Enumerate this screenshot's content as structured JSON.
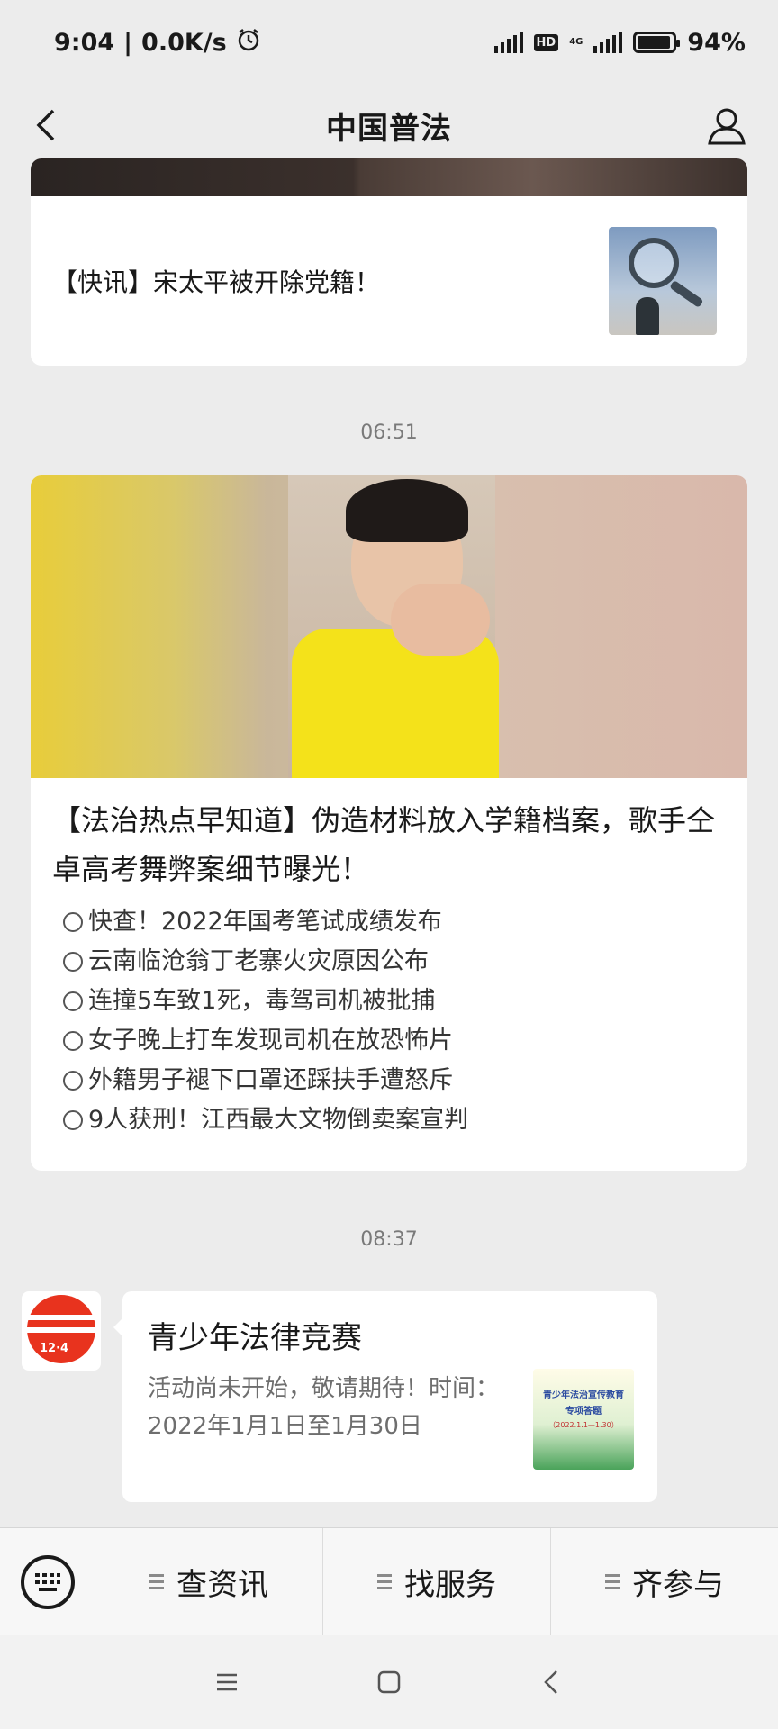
{
  "status_bar": {
    "time": "9:04",
    "net_speed": "0.0K/s",
    "hd": "HD",
    "network": "4G",
    "battery": "94%",
    "battery_level": 0.94,
    "icons": [
      "alarm-icon",
      "signal-icon",
      "battery-icon"
    ]
  },
  "nav": {
    "title": "中国普法",
    "back_icon": "chevron-left-icon",
    "profile_icon": "person-icon"
  },
  "messages": {
    "article1": {
      "title": "【快讯】宋太平被开除党籍！"
    },
    "time1": "06:51",
    "article2": {
      "title": "【法治热点早知道】伪造材料放入学籍档案，歌手仝卓高考舞弊案细节曝光！",
      "items": [
        "快查！2022年国考笔试成绩发布",
        "云南临沧翁丁老寨火灾原因公布",
        "连撞5车致1死，毒驾司机被批捕",
        "女子晚上打车发现司机在放恐怖片",
        "外籍男子褪下口罩还踩扶手遭怒斥",
        "9人获刑！江西最大文物倒卖案宣判"
      ]
    },
    "time2": "08:37",
    "mini_program": {
      "title": "青少年法律竞赛",
      "desc": "活动尚未开始，敬请期待！时间：2022年1月1日至1月30日",
      "thumb_line1": "青少年法治宣传教育",
      "thumb_line2": "专项答题",
      "thumb_line3": "（2022.1.1—1.30）",
      "avatar_label": "12·4"
    }
  },
  "menu": {
    "keyboard_icon": "keyboard-icon",
    "items": [
      "查资讯",
      "找服务",
      "齐参与"
    ]
  },
  "system_nav": {
    "icons": [
      "menu-icon",
      "home-icon",
      "back-icon"
    ]
  }
}
